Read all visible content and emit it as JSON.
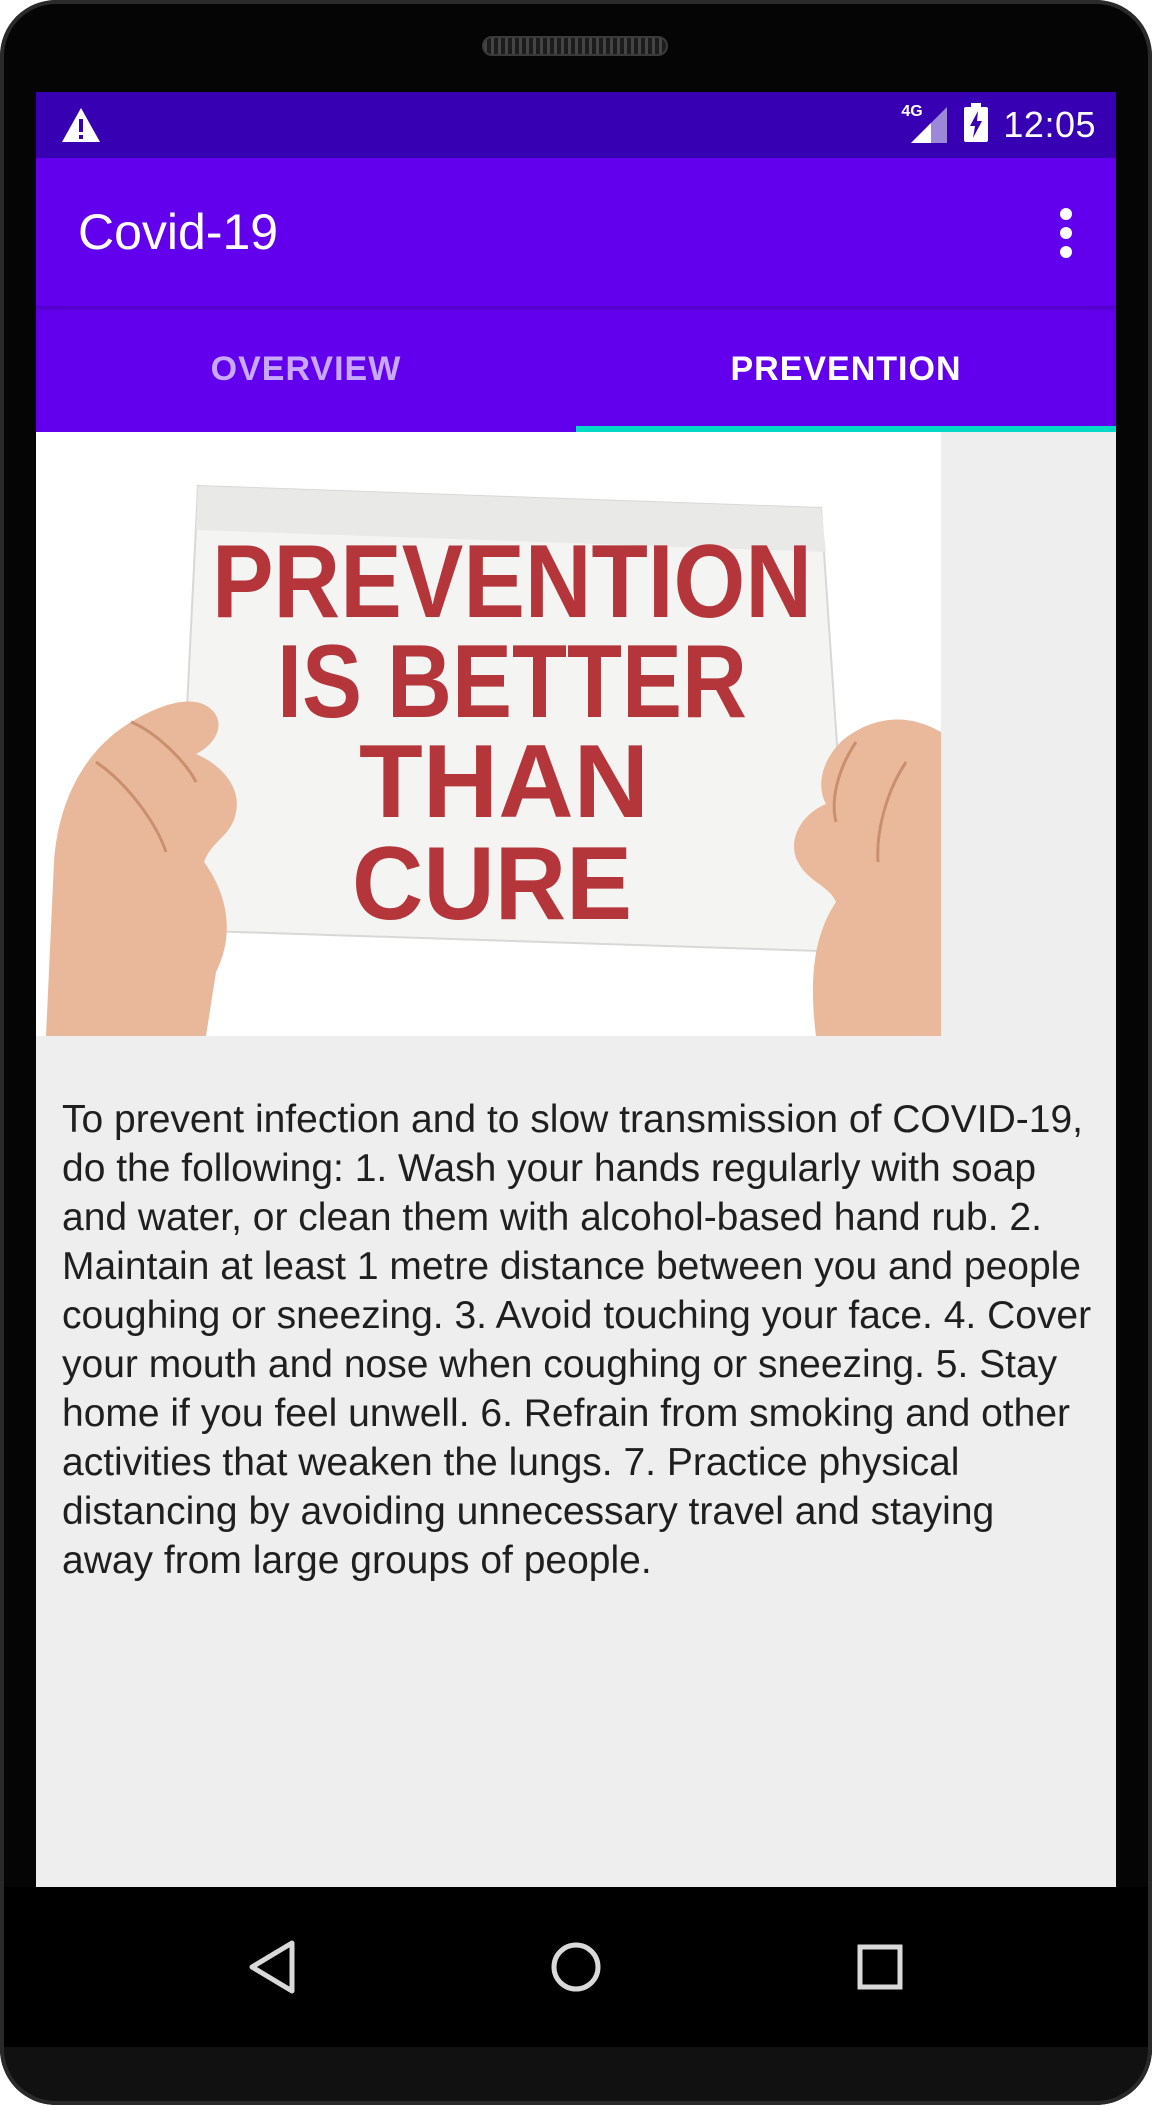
{
  "status_bar": {
    "time": "12:05",
    "network": "4G",
    "warning_icon": "warning-triangle-icon",
    "signal_icon": "cell-signal-icon",
    "battery_icon": "battery-charging-icon"
  },
  "app_bar": {
    "title": "Covid-19",
    "menu_icon": "more-vert-icon"
  },
  "tabs": [
    {
      "label": "OVERVIEW",
      "selected": false
    },
    {
      "label": "PREVENTION",
      "selected": true
    }
  ],
  "hero_image": {
    "sign_lines": [
      "PREVENTION",
      "IS BETTER",
      "THAN",
      "CURE"
    ]
  },
  "content": {
    "body": "To prevent infection and to slow transmission of COVID-19, do the following: 1. Wash your hands regularly with soap and water, or clean them with alcohol-based hand rub. 2. Maintain at least 1 metre distance between you and people coughing or sneezing. 3. Avoid touching your face. 4. Cover your mouth and nose when coughing or sneezing. 5. Stay home if you feel unwell. 6. Refrain from smoking and other activities that weaken the lungs. 7. Practice physical distancing by avoiding unnecessary travel and staying away from large groups of people."
  },
  "nav_bar": {
    "back_icon": "back-triangle-icon",
    "home_icon": "home-circle-icon",
    "recents_icon": "recents-square-icon"
  },
  "colors": {
    "status_bar": "#3700b3",
    "primary": "#6200ee",
    "tab_indicator": "#03dac5",
    "sign_text": "#b5363a",
    "background": "#eeeeee"
  }
}
